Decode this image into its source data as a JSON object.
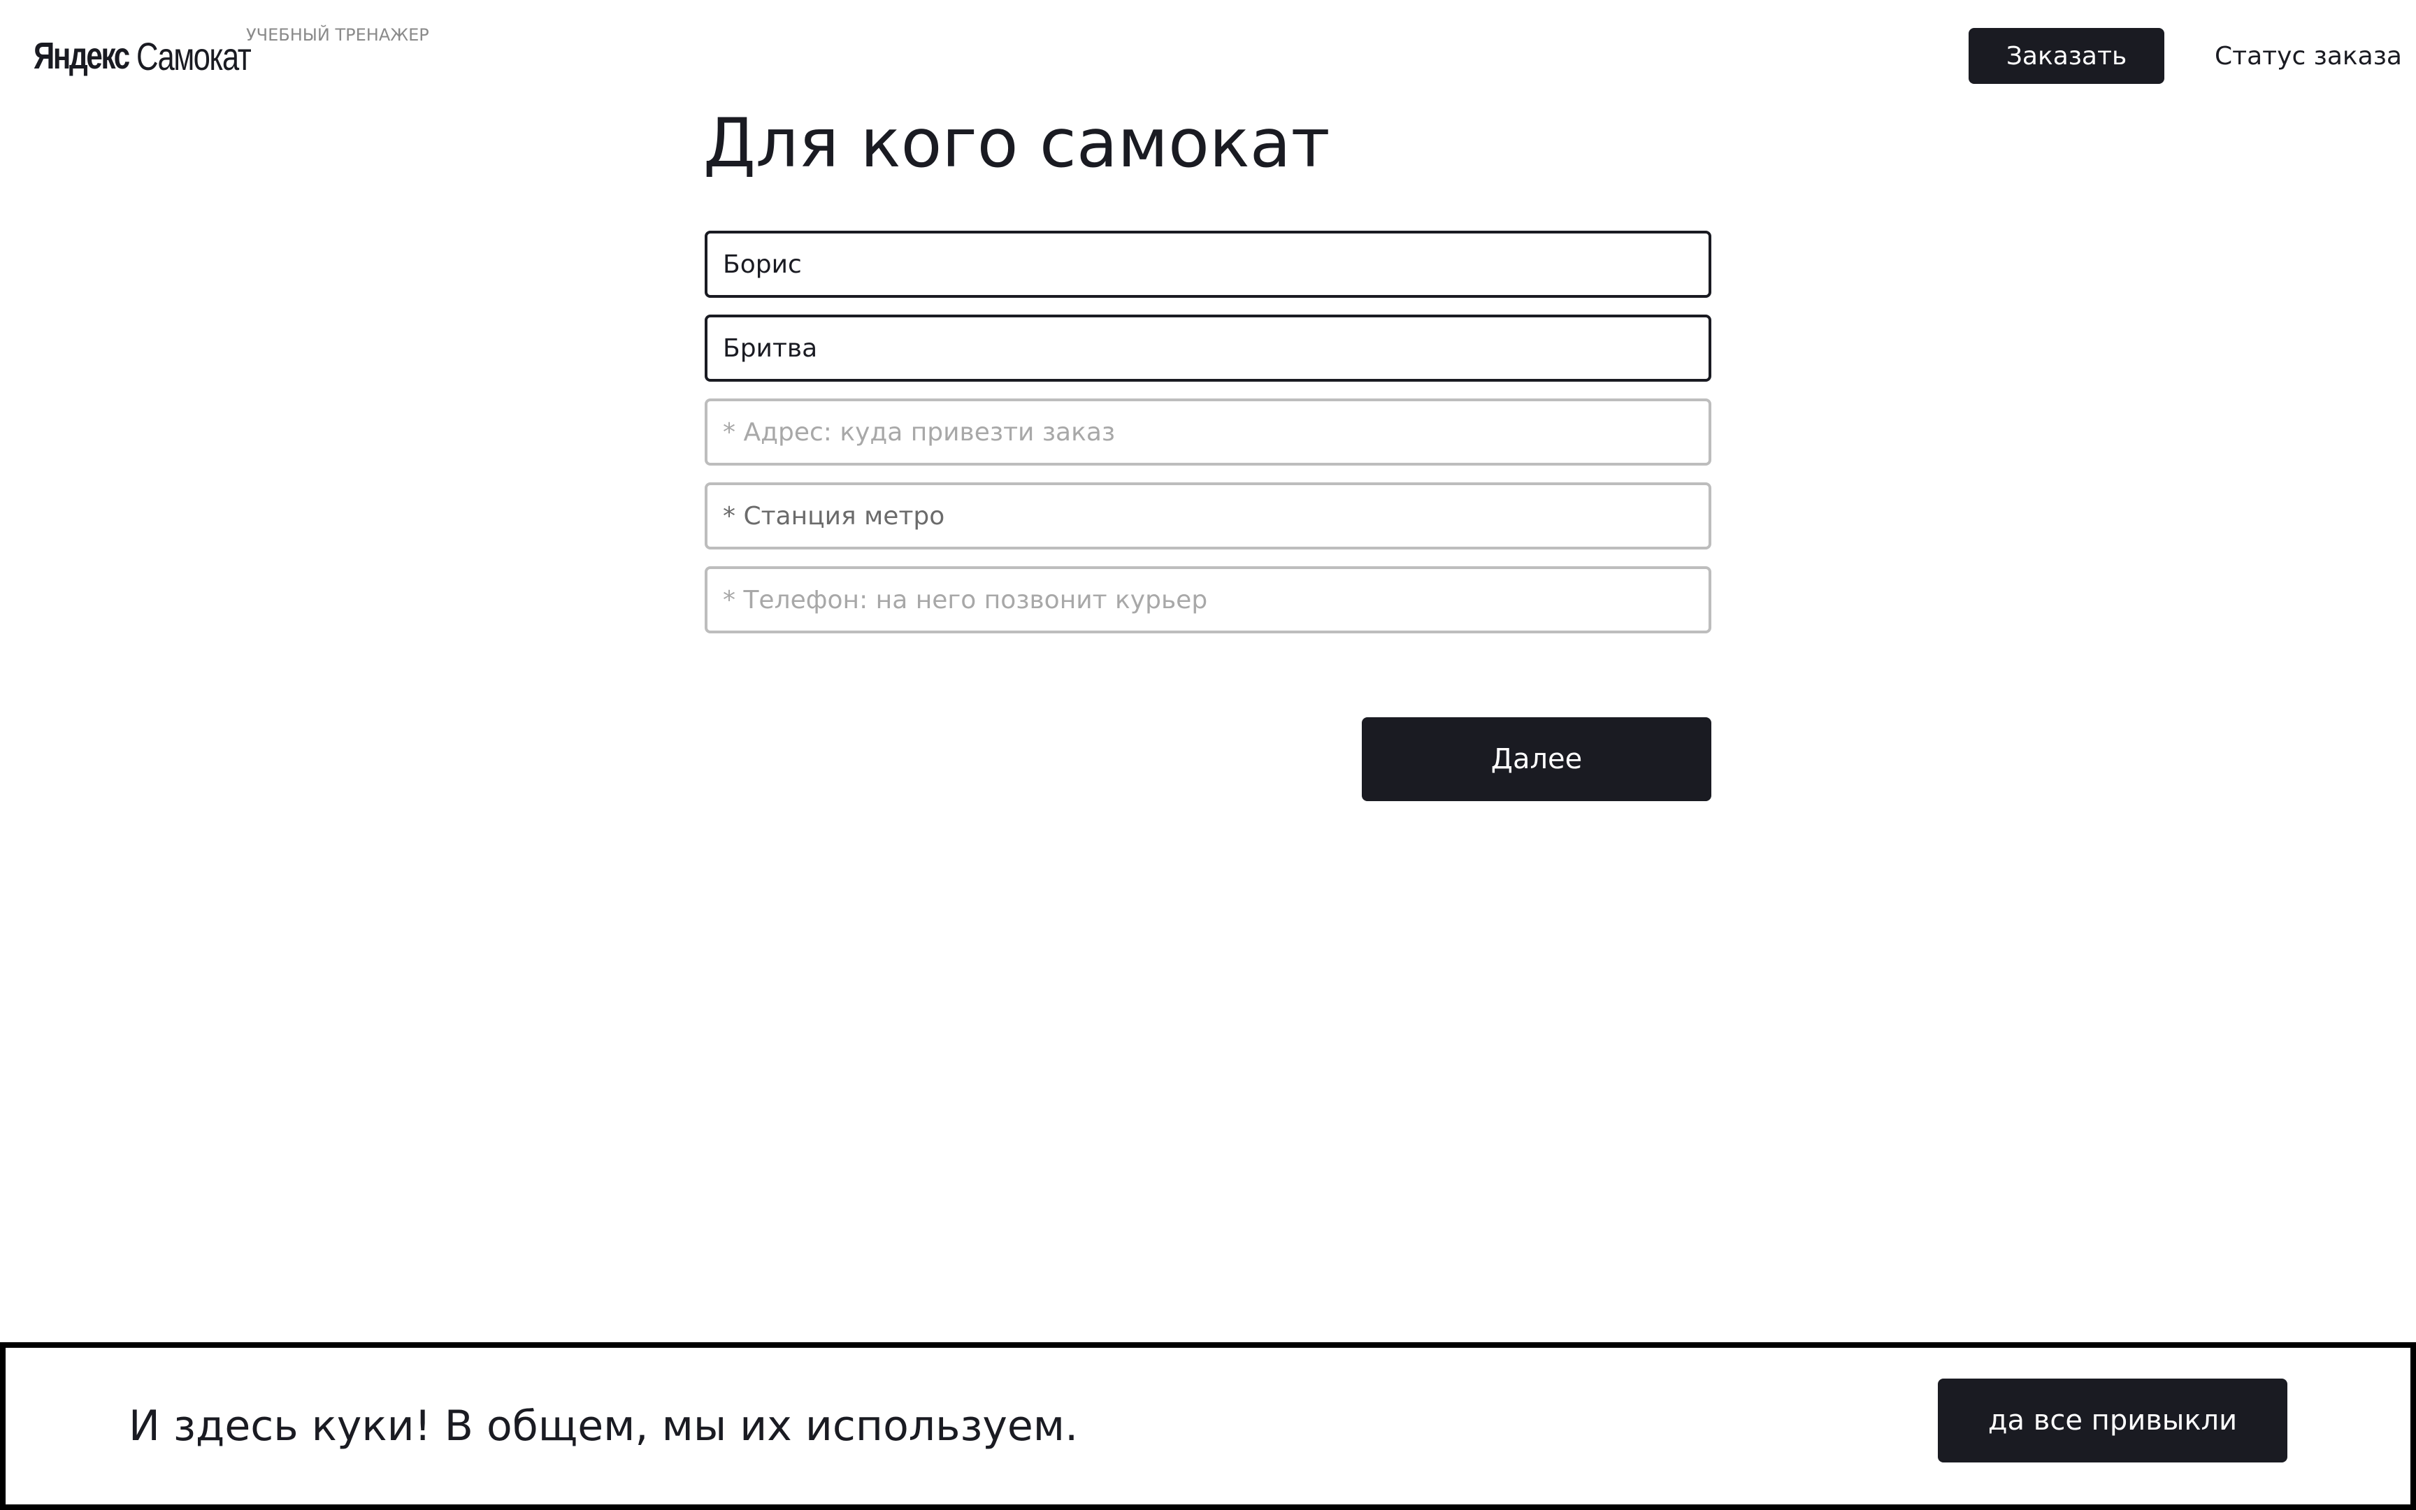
{
  "header": {
    "logo": {
      "brand": "Яндекс",
      "product": "Самокат",
      "subtitle": "УЧЕБНЫЙ ТРЕНАЖЕР"
    },
    "order_button": "Заказать",
    "status_link": "Статус заказа"
  },
  "form": {
    "title": "Для кого самокат",
    "fields": [
      {
        "name": "first-name",
        "value": "Борис",
        "placeholder": ""
      },
      {
        "name": "last-name",
        "value": "Бритва",
        "placeholder": ""
      },
      {
        "name": "address",
        "value": "",
        "placeholder": "* Адрес: куда привезти заказ"
      },
      {
        "name": "metro-station",
        "value": "",
        "placeholder": "* Станция метро"
      },
      {
        "name": "phone",
        "value": "",
        "placeholder": "* Телефон: на него позвонит курьер"
      }
    ],
    "next_button": "Далее"
  },
  "cookie_banner": {
    "text": "И здесь куки! В общем, мы их используем.",
    "accept_button": "да все привыкли"
  },
  "colors": {
    "primary_dark": "#1a1b22",
    "field_border": "#bdbdbd",
    "field_border_filled": "#1a1b22",
    "placeholder": "#a8a8a8",
    "background": "#ffffff"
  }
}
